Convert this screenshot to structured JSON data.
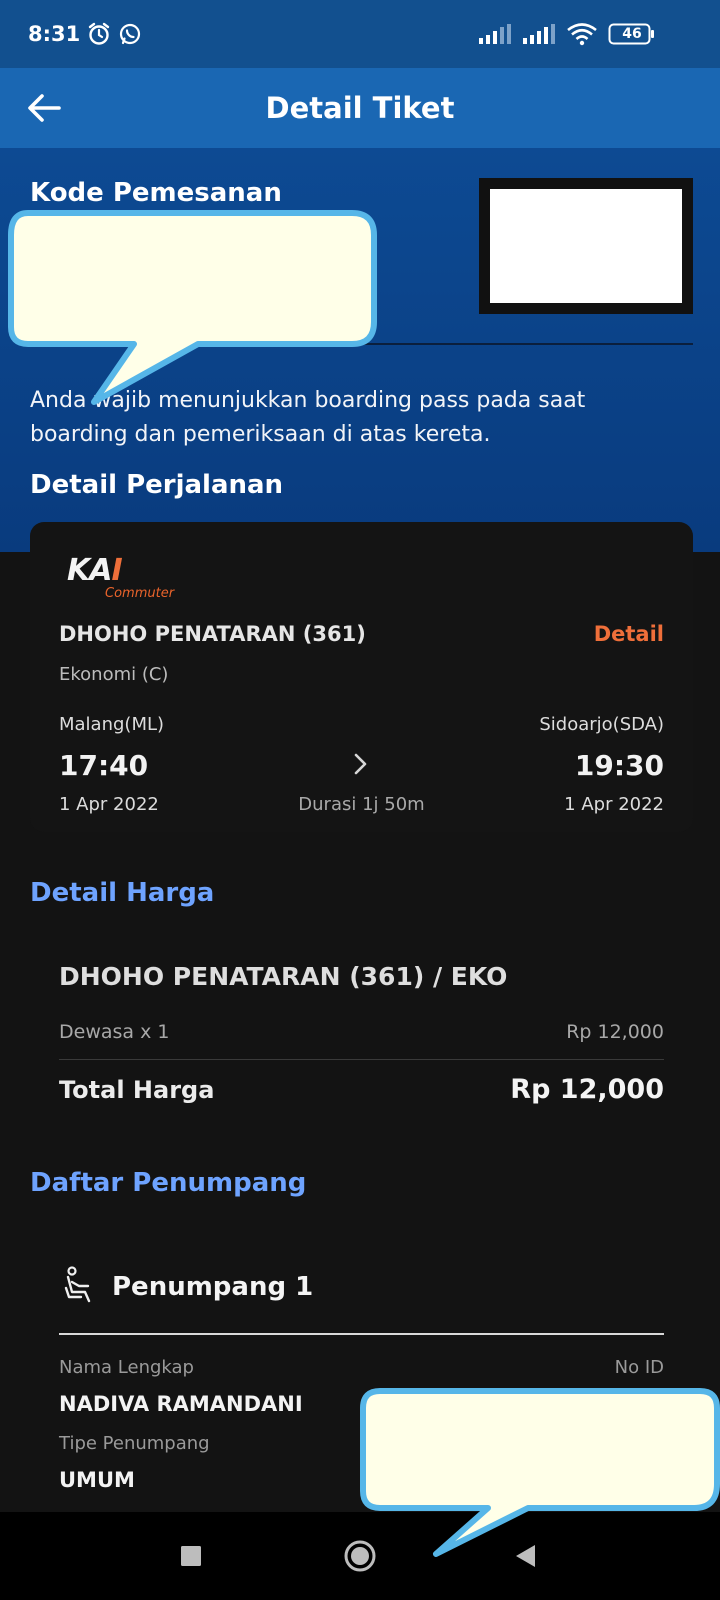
{
  "status_bar": {
    "time": "8:31",
    "battery": "46",
    "icons": [
      "alarm-icon",
      "whatsapp-icon",
      "signal-icon",
      "signal-icon",
      "wifi-icon",
      "battery-icon"
    ]
  },
  "app_bar": {
    "title": "Detail Tiket",
    "back_icon": "back-arrow-icon"
  },
  "booking": {
    "code_label": "Kode Pemesanan",
    "notice": "Anda wajib menunjukkan boarding pass pada saat boarding dan pemeriksaan di atas kereta."
  },
  "trip": {
    "heading": "Detail Perjalanan",
    "logo_text": "KAI",
    "logo_sub": "Commuter",
    "train_name": "DHOHO PENATARAN (361)",
    "detail_link": "Detail",
    "train_class": "Ekonomi (C)",
    "origin": "Malang(ML)",
    "destination": "Sidoarjo(SDA)",
    "departure_time": "17:40",
    "arrival_time": "19:30",
    "departure_date": "1 Apr 2022",
    "arrival_date": "1 Apr 2022",
    "duration": "Durasi 1j 50m"
  },
  "price": {
    "heading": "Detail Harga",
    "item": "DHOHO PENATARAN (361) / EKO",
    "adult_label": "Dewasa x 1",
    "adult_price": "Rp 12,000",
    "total_label": "Total Harga",
    "total_value": "Rp 12,000"
  },
  "passengers": {
    "heading": "Daftar Penumpang",
    "title": "Penumpang 1",
    "name_label": "Nama Lengkap",
    "id_label": "No ID",
    "name_value": "NADIVA RAMANDANI",
    "type_label": "Tipe Penumpang",
    "type_value": "UMUM"
  },
  "colors": {
    "primary_blue": "#1a67b3",
    "header_blue": "#0d4a93",
    "accent_orange": "#ef6f3a",
    "link_blue": "#6ea3ff",
    "bubble_fill": "#ffffe8",
    "bubble_border": "#56b6e8"
  }
}
